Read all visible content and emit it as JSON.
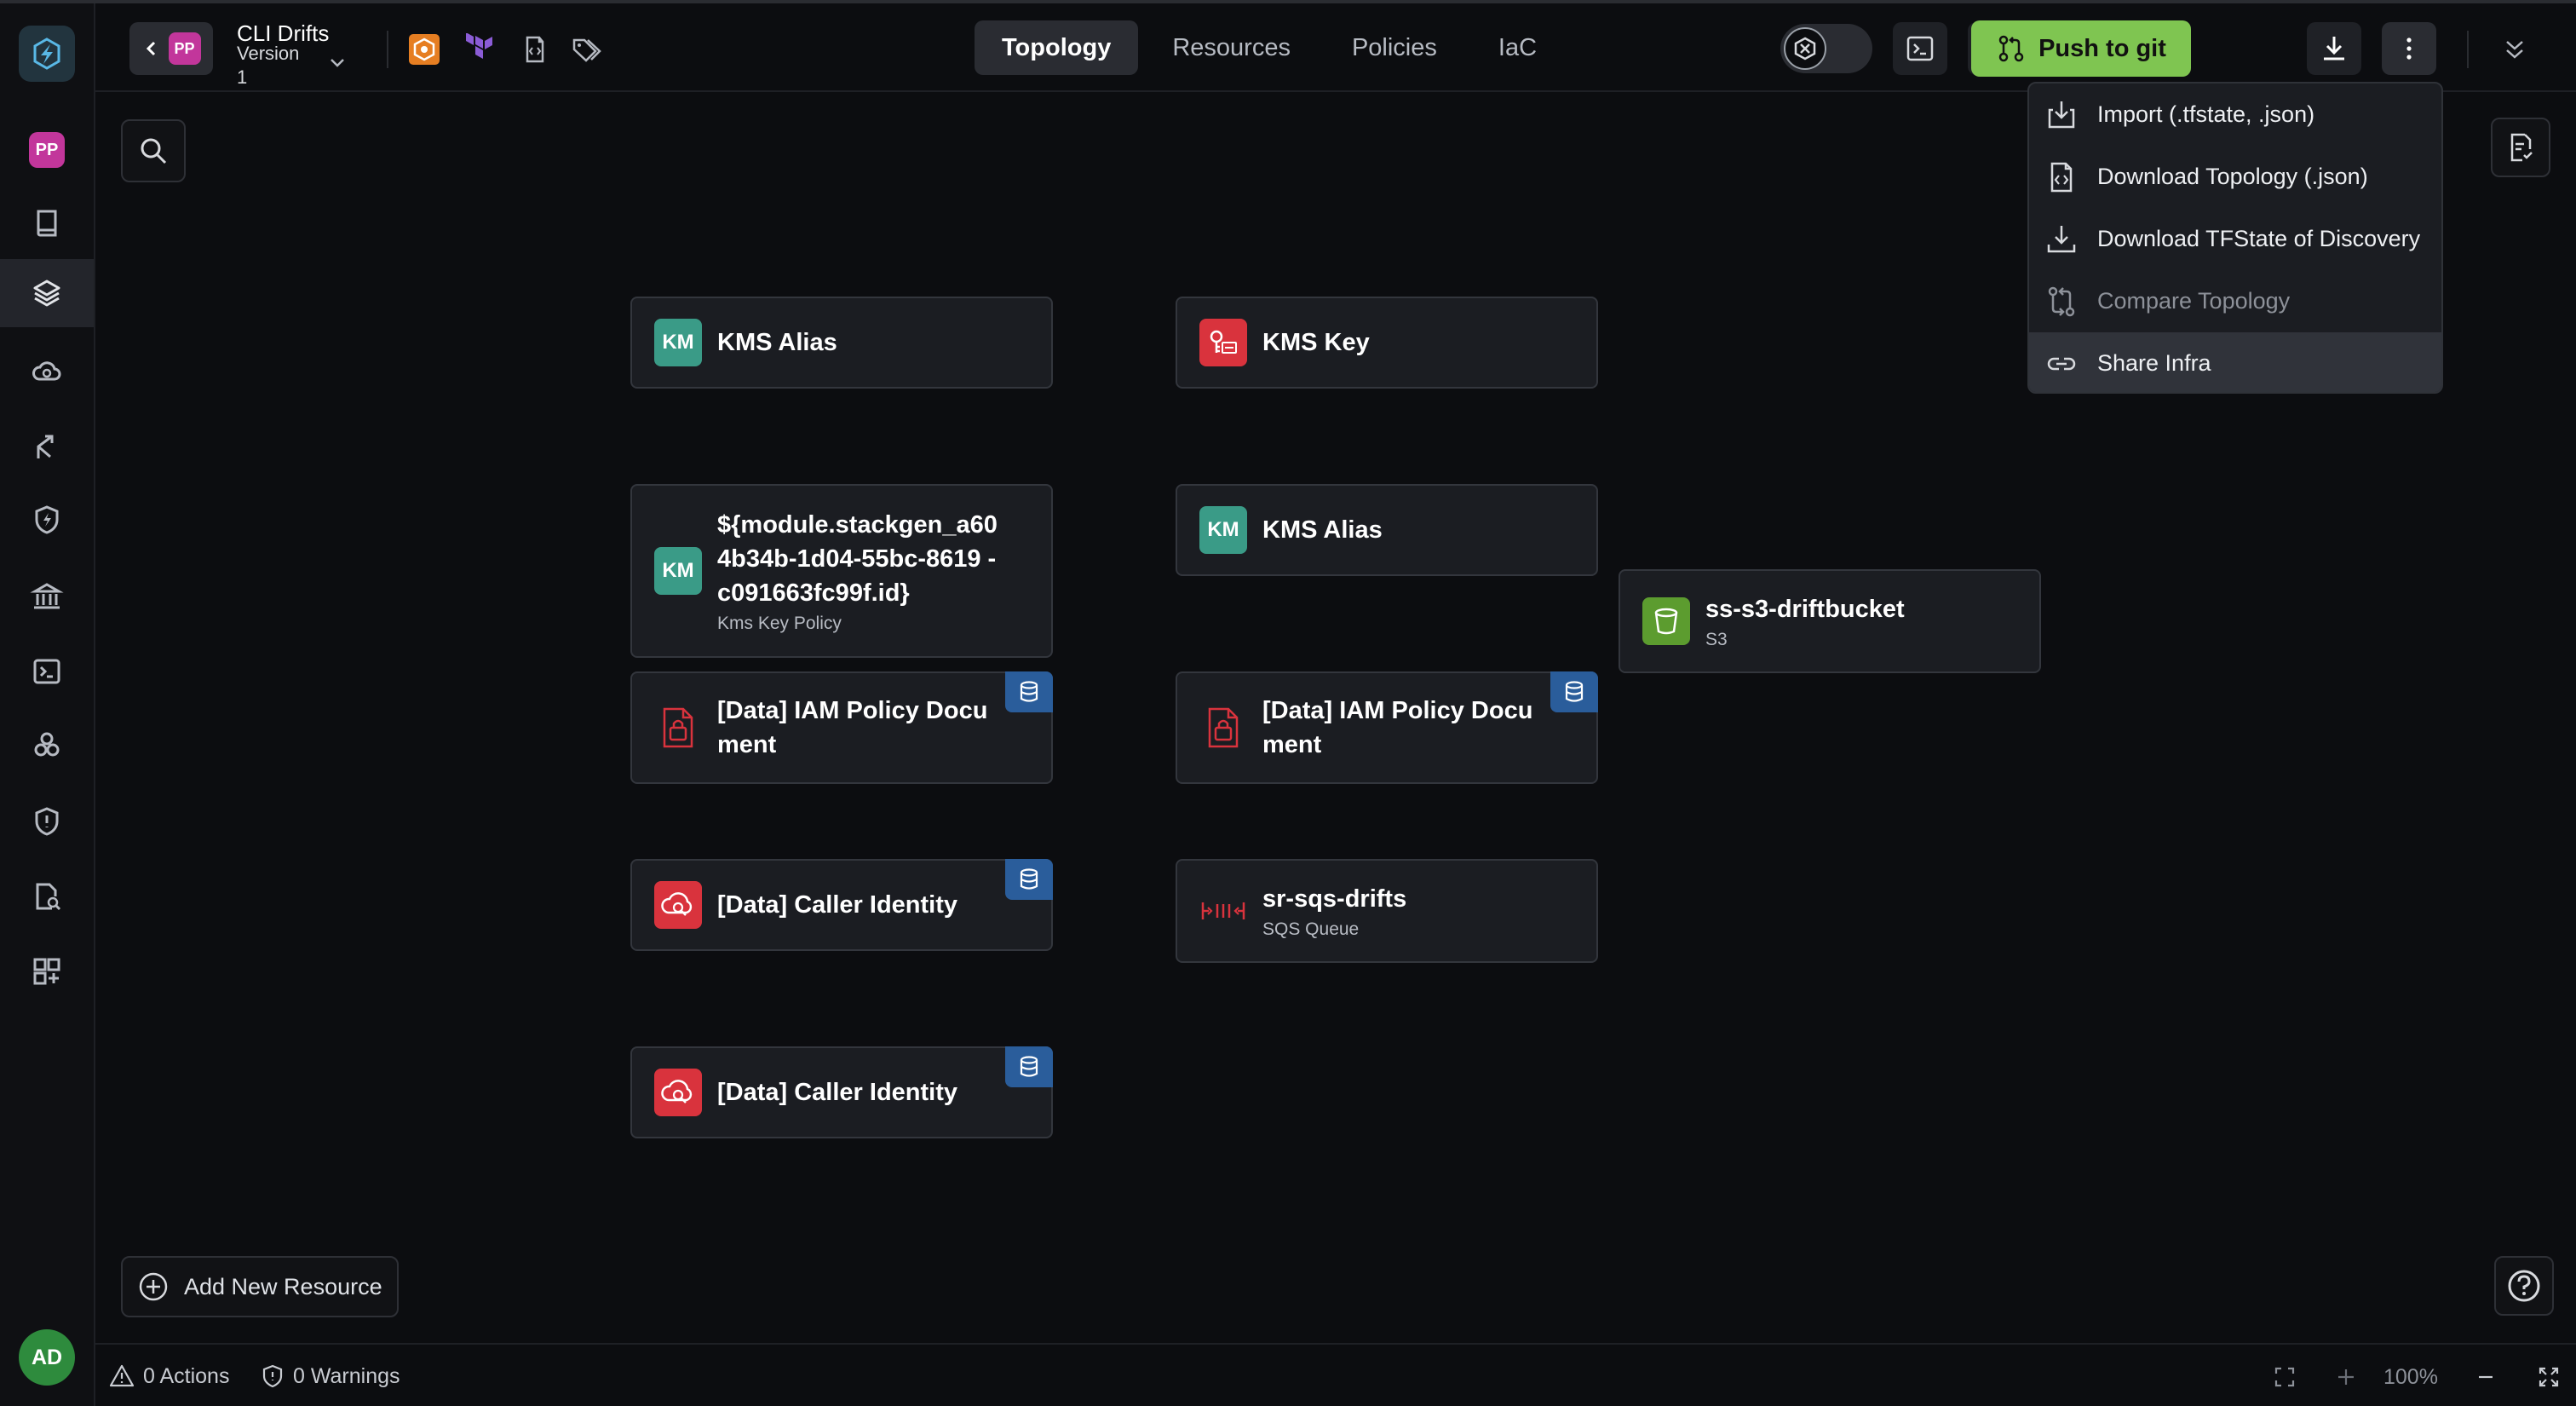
{
  "sidebar": {
    "project_initials": "PP",
    "user_initials": "AD",
    "items": [
      {
        "icon": "book-icon"
      },
      {
        "icon": "layers-icon"
      },
      {
        "icon": "cloud-search-icon"
      },
      {
        "icon": "branch-icon"
      },
      {
        "icon": "shield-bolt-icon"
      },
      {
        "icon": "bank-icon"
      },
      {
        "icon": "terminal-icon"
      },
      {
        "icon": "cubes-icon"
      },
      {
        "icon": "shield-alert-icon"
      },
      {
        "icon": "document-search-icon"
      },
      {
        "icon": "add-widget-icon"
      }
    ]
  },
  "header": {
    "project_initials": "PP",
    "project_name": "CLI Drifts",
    "version_label": "Version",
    "version_value": "1",
    "tabs": [
      {
        "label": "Topology",
        "active": true
      },
      {
        "label": "Resources",
        "active": false
      },
      {
        "label": "Policies",
        "active": false
      },
      {
        "label": "IaC",
        "active": false
      }
    ],
    "push_label": "Push to git"
  },
  "menu": {
    "items": [
      {
        "label": "Import (.tfstate, .json)",
        "icon": "import-icon",
        "state": "normal"
      },
      {
        "label": "Download Topology (.json)",
        "icon": "file-code-icon",
        "state": "normal"
      },
      {
        "label": "Download TFState of Discovery",
        "icon": "download-tray-icon",
        "state": "normal"
      },
      {
        "label": "Compare Topology",
        "icon": "compare-icon",
        "state": "disabled"
      },
      {
        "label": "Share Infra",
        "icon": "link-icon",
        "state": "hover"
      }
    ]
  },
  "nodes": [
    {
      "title": "KMS Alias",
      "subtitle": "",
      "icon_text": "KM"
    },
    {
      "title": "KMS Key",
      "subtitle": ""
    },
    {
      "title": "${module.stackgen_a60 4b34b-1d04-55bc-8619 -c091663fc99f.id}",
      "subtitle": "Kms Key Policy",
      "icon_text": "KM"
    },
    {
      "title": "KMS Alias",
      "subtitle": "",
      "icon_text": "KM"
    },
    {
      "title": "ss-s3-driftbucket",
      "subtitle": "S3"
    },
    {
      "title": "[Data] IAM Policy Docu ment",
      "subtitle": ""
    },
    {
      "title": "[Data] IAM Policy Docu ment",
      "subtitle": ""
    },
    {
      "title": "[Data] Caller Identity",
      "subtitle": ""
    },
    {
      "title": "sr-sqs-drifts",
      "subtitle": "SQS Queue"
    },
    {
      "title": "[Data] Caller Identity",
      "subtitle": ""
    }
  ],
  "canvas": {
    "add_resource_label": "Add New Resource"
  },
  "footer": {
    "actions": "0 Actions",
    "warnings": "0 Warnings",
    "zoom": "100%"
  },
  "colors": {
    "accent_green": "#7fc551",
    "kms_teal": "#3a9b87",
    "danger_red": "#d9333d",
    "data_badge_blue": "#2a5d9b",
    "project_pink": "#c2369b"
  }
}
